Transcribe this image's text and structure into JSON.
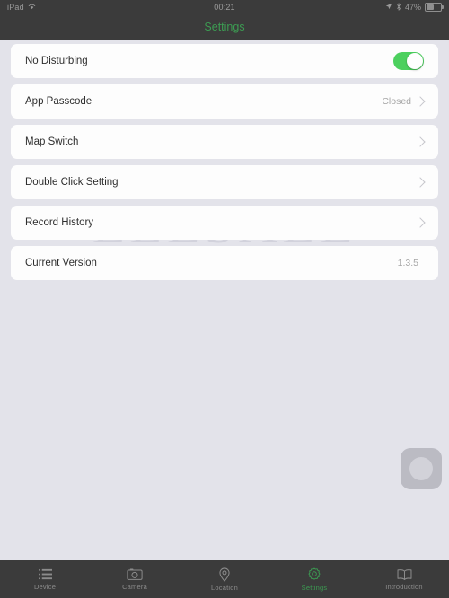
{
  "statusbar": {
    "device": "iPad",
    "wifi_icon": "wifi-icon",
    "time": "00:21",
    "location_icon": "location-arrow-icon",
    "bluetooth_icon": "bluetooth-icon",
    "battery_percent": "47%",
    "battery_icon": "battery-icon"
  },
  "navbar": {
    "title": "Settings",
    "title_color": "#3c9b52"
  },
  "watermark": {
    "text": "ELESALE"
  },
  "settings": {
    "rows": [
      {
        "label": "No Disturbing",
        "accessory": "toggle",
        "toggle_on": true,
        "value": ""
      },
      {
        "label": "App Passcode",
        "accessory": "chevron",
        "value": "Closed"
      },
      {
        "label": "Map Switch",
        "accessory": "chevron",
        "value": ""
      },
      {
        "label": "Double Click Setting",
        "accessory": "chevron",
        "value": ""
      },
      {
        "label": "Record History",
        "accessory": "chevron",
        "value": ""
      },
      {
        "label": "Current Version",
        "accessory": "none",
        "value": "1.3.5"
      }
    ]
  },
  "assistive_touch": {
    "name": "assistive-touch-button"
  },
  "tabbar": {
    "active_color": "#3c9b52",
    "inactive_color": "#8b8b8b",
    "tabs": [
      {
        "label": "Device",
        "icon": "list-icon",
        "active": false
      },
      {
        "label": "Camera",
        "icon": "camera-icon",
        "active": false
      },
      {
        "label": "Location",
        "icon": "map-pin-icon",
        "active": false
      },
      {
        "label": "Settings",
        "icon": "gear-icon",
        "active": true
      },
      {
        "label": "Introduction",
        "icon": "book-icon",
        "active": false
      }
    ]
  },
  "colors": {
    "background": "#e3e3ea",
    "card": "#fdfdfd",
    "chrome": "#3b3b3b",
    "accent_green": "#3c9b52",
    "toggle_green": "#4cd05e"
  }
}
